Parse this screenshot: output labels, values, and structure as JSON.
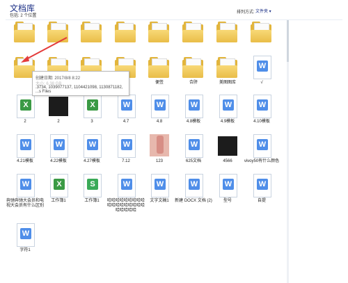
{
  "header": {
    "title": "文档库",
    "subtitle": "包括: 2 个位置",
    "arrange_label": "排列方式:",
    "arrange_value": "文件夹 ▾"
  },
  "tooltip": {
    "line1": "创建日期: 2017/8/8 8:22",
    "line2": "大小: 6.38 GB",
    "line3": ".3734, 1039077137, 1104421098, 1130871182, ...s Files"
  },
  "row1": [
    {
      "type": "folder",
      "label": ""
    },
    {
      "type": "folder",
      "label": ""
    },
    {
      "type": "folder",
      "label": ""
    },
    {
      "type": "folder",
      "label": ""
    },
    {
      "type": "folder",
      "label": ""
    },
    {
      "type": "folder",
      "label": ""
    },
    {
      "type": "folder",
      "label": ""
    },
    {
      "type": "folder",
      "label": ""
    }
  ],
  "row2": [
    {
      "type": "folder",
      "label": ""
    },
    {
      "type": "folder",
      "label": ""
    },
    {
      "type": "folder",
      "label": ""
    },
    {
      "type": "folder",
      "label": ""
    },
    {
      "type": "folder",
      "label": "便签"
    },
    {
      "type": "folder",
      "label": "合肝"
    },
    {
      "type": "folder",
      "label": "美图图库"
    },
    {
      "type": "word",
      "label": "√"
    }
  ],
  "row3": [
    {
      "type": "excel",
      "label": "2"
    },
    {
      "type": "image-dark",
      "label": "2"
    },
    {
      "type": "excel",
      "label": "3"
    },
    {
      "type": "word",
      "label": "4.7"
    },
    {
      "type": "word",
      "label": "4.8"
    },
    {
      "type": "word",
      "label": "4.8模板"
    },
    {
      "type": "word",
      "label": "4.9模板"
    },
    {
      "type": "word",
      "label": "4.10模板"
    }
  ],
  "row4": [
    {
      "type": "word",
      "label": "4.21模板"
    },
    {
      "type": "word",
      "label": "4.22模板"
    },
    {
      "type": "word",
      "label": "4.27模板"
    },
    {
      "type": "word",
      "label": "7.12"
    },
    {
      "type": "image-phone",
      "label": "123"
    },
    {
      "type": "word",
      "label": "625文档"
    },
    {
      "type": "image-dark",
      "label": "4566"
    },
    {
      "type": "word",
      "label": "vivoy50有什么颜色"
    }
  ],
  "row5": [
    {
      "type": "word",
      "label": "奔驰奔驰大会员和电视大会员有什么区别"
    },
    {
      "type": "excel",
      "label": "工作簿1"
    },
    {
      "type": "sheet",
      "label": "工作簿1"
    },
    {
      "type": "word",
      "label": "哈哈哈哈哈哈哈哈哈哈哈哈哈哈哈哈哈哈哈哈哈哈哈"
    },
    {
      "type": "word",
      "label": "文字文稿1"
    },
    {
      "type": "word",
      "label": "新建 DOCX 文档 (2)"
    },
    {
      "type": "word",
      "label": "型号"
    },
    {
      "type": "word",
      "label": "自提"
    }
  ],
  "row6": [
    {
      "type": "word",
      "label": "字符1"
    }
  ]
}
